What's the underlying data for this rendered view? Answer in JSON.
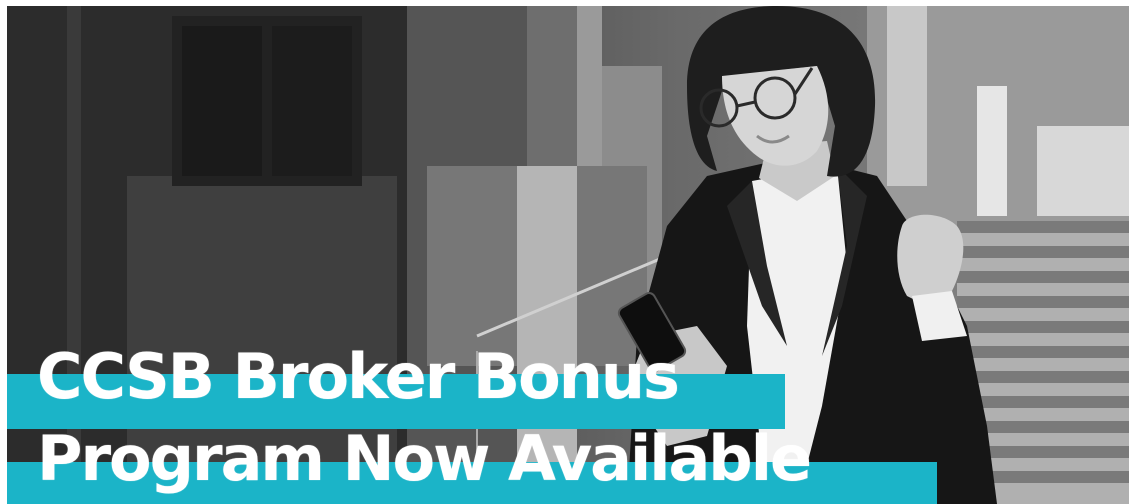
{
  "hero": {
    "headline_line_1": "CCSB Broker Bonus",
    "headline_line_2": "Program Now Available",
    "accent_color": "#1bb4c8",
    "text_color": "#ffffff",
    "image_treatment": "grayscale photo",
    "photo_icon": "woman-celebrating-with-phone-icon"
  }
}
